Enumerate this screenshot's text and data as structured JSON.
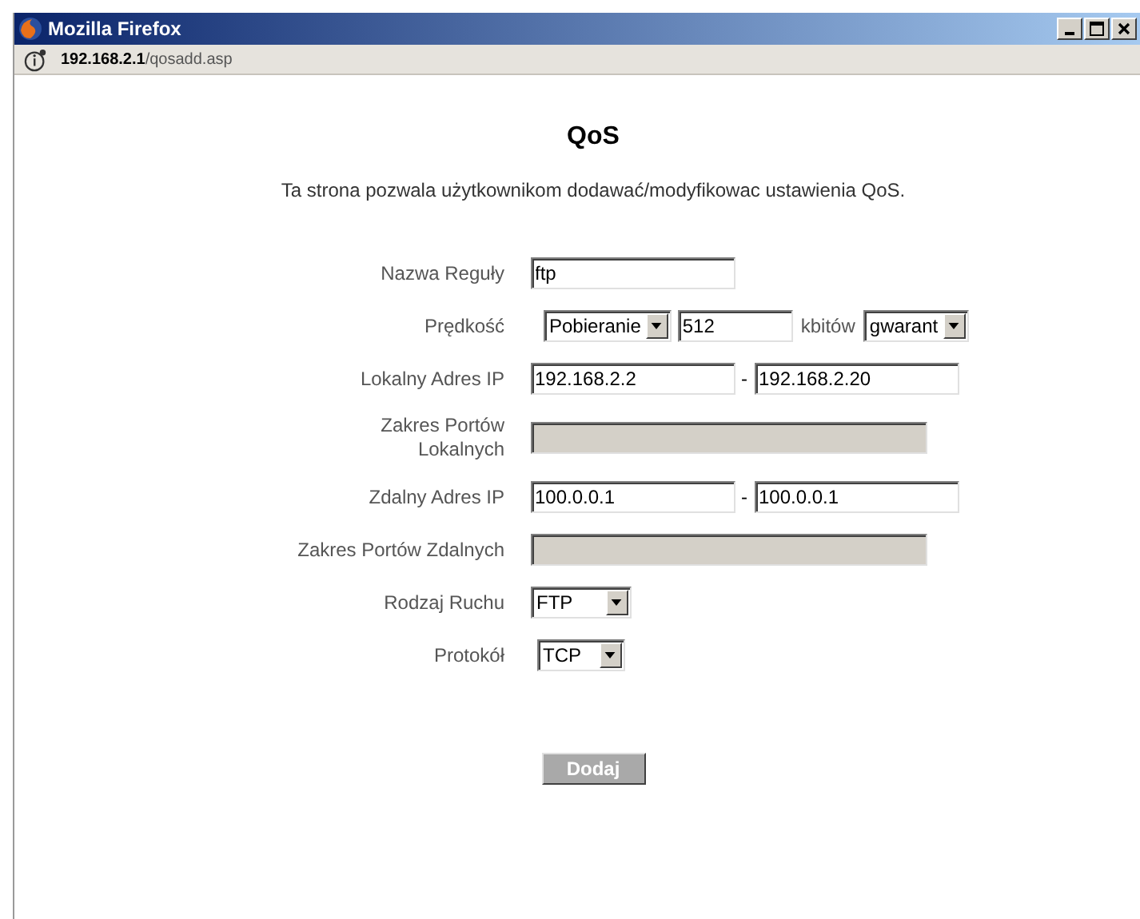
{
  "window": {
    "title": "Mozilla Firefox"
  },
  "address": {
    "host": "192.168.2.1",
    "path": "/qosadd.asp"
  },
  "page": {
    "title": "QoS",
    "description": "Ta strona pozwala użytkownikom dodawać/modyfikowac ustawienia QoS."
  },
  "rows": [
    {
      "kind": "text",
      "label": "Nazwa Reguły",
      "value": "ftp"
    },
    {
      "kind": "speed",
      "label": "Prędkość",
      "direction": "Pobieranie",
      "amount": "512",
      "unit": "kbitów",
      "mode": "gwarant"
    },
    {
      "kind": "range",
      "label": "Lokalny Adres IP",
      "from": "192.168.2.2",
      "separator": "-",
      "to": "192.168.2.20"
    },
    {
      "kind": "disabled",
      "label": "Zakres Portów\nLokalnych"
    },
    {
      "kind": "range",
      "label": "Zdalny Adres IP",
      "from": "100.0.0.1",
      "separator": "-",
      "to": "100.0.0.1"
    },
    {
      "kind": "disabled",
      "label": "Zakres Portów Zdalnych"
    },
    {
      "kind": "select",
      "label": "Rodzaj Ruchu",
      "value": "FTP"
    },
    {
      "kind": "select-small",
      "label": "Protokół",
      "value": "TCP"
    }
  ],
  "button": "Dodaj"
}
